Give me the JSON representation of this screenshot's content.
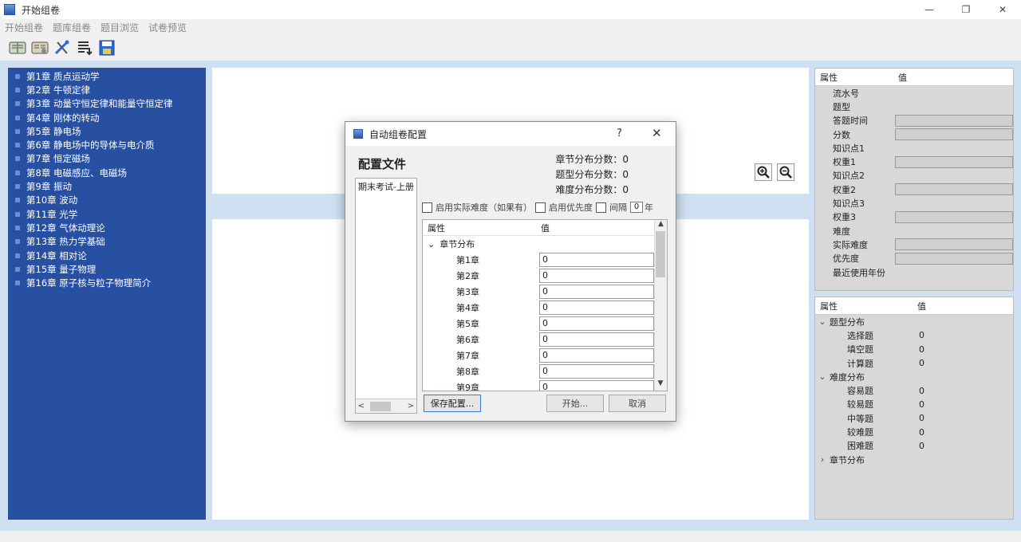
{
  "window": {
    "title": "开始组卷",
    "minimize": "—",
    "maximize": "❐",
    "close": "✕"
  },
  "menu": [
    "开始组卷",
    "题库组卷",
    "题目浏览",
    "试卷预览"
  ],
  "toolbar": [
    "book-edit-icon",
    "book-open-icon",
    "tools-icon",
    "list-icon",
    "save-icon"
  ],
  "chapters": [
    "第1章 质点运动学",
    "第2章 牛顿定律",
    "第3章 动量守恒定律和能量守恒定律",
    "第4章 刚体的转动",
    "第5章 静电场",
    "第6章 静电场中的导体与电介质",
    "第7章 恒定磁场",
    "第8章 电磁感应、电磁场",
    "第9章 振动",
    "第10章 波动",
    "第11章 光学",
    "第12章 气体动理论",
    "第13章 热力学基础",
    "第14章 相对论",
    "第15章 量子物理",
    "第16章 原子核与粒子物理简介"
  ],
  "props_top": {
    "header": {
      "key": "属性",
      "value": "值"
    },
    "rows": [
      {
        "label": "流水号",
        "box": false
      },
      {
        "label": "题型",
        "box": false
      },
      {
        "label": "答题时间",
        "box": true
      },
      {
        "label": "分数",
        "box": true
      },
      {
        "label": "知识点1",
        "box": false
      },
      {
        "label": "权重1",
        "box": true
      },
      {
        "label": "知识点2",
        "box": false
      },
      {
        "label": "权重2",
        "box": true
      },
      {
        "label": "知识点3",
        "box": false
      },
      {
        "label": "权重3",
        "box": true
      },
      {
        "label": "难度",
        "box": false
      },
      {
        "label": "实际难度",
        "box": true
      },
      {
        "label": "优先度",
        "box": true
      },
      {
        "label": "最近使用年份",
        "box": false
      }
    ]
  },
  "props_bottom": {
    "header": {
      "key": "属性",
      "value": "值"
    },
    "rows": [
      {
        "caret": "⌄",
        "label": "题型分布",
        "value": "",
        "leaf": false
      },
      {
        "caret": "",
        "label": "选择题",
        "value": "0",
        "leaf": true
      },
      {
        "caret": "",
        "label": "填空题",
        "value": "0",
        "leaf": true
      },
      {
        "caret": "",
        "label": "计算题",
        "value": "0",
        "leaf": true
      },
      {
        "caret": "⌄",
        "label": "难度分布",
        "value": "",
        "leaf": false
      },
      {
        "caret": "",
        "label": "容易题",
        "value": "0",
        "leaf": true
      },
      {
        "caret": "",
        "label": "较易题",
        "value": "0",
        "leaf": true
      },
      {
        "caret": "",
        "label": "中等题",
        "value": "0",
        "leaf": true
      },
      {
        "caret": "",
        "label": "较难题",
        "value": "0",
        "leaf": true
      },
      {
        "caret": "",
        "label": "困难题",
        "value": "0",
        "leaf": true
      },
      {
        "caret": "›",
        "label": "章节分布",
        "value": "",
        "leaf": false
      }
    ]
  },
  "dialog": {
    "title": "自动组卷配置",
    "help": "?",
    "close": "✕",
    "config_label": "配置文件",
    "stats": [
      "章节分布分数：0",
      "题型分布分数：0",
      "难度分布分数：0"
    ],
    "files": [
      "期末考试-上册"
    ],
    "options": {
      "opt1": "启用实际难度（如果有）",
      "opt2": "启用优先度",
      "opt3": "间隔",
      "interval": "0",
      "unit": "年"
    },
    "grid": {
      "header": {
        "key": "属性",
        "value": "值"
      },
      "group": "章节分布",
      "rows": [
        {
          "label": "第1章",
          "value": "0"
        },
        {
          "label": "第2章",
          "value": "0"
        },
        {
          "label": "第3章",
          "value": "0"
        },
        {
          "label": "第4章",
          "value": "0"
        },
        {
          "label": "第5章",
          "value": "0"
        },
        {
          "label": "第6章",
          "value": "0"
        },
        {
          "label": "第7章",
          "value": "0"
        },
        {
          "label": "第8章",
          "value": "0"
        },
        {
          "label": "第9章",
          "value": "0"
        }
      ]
    },
    "buttons": {
      "save": "保存配置...",
      "start": "开始...",
      "cancel": "取消"
    }
  }
}
